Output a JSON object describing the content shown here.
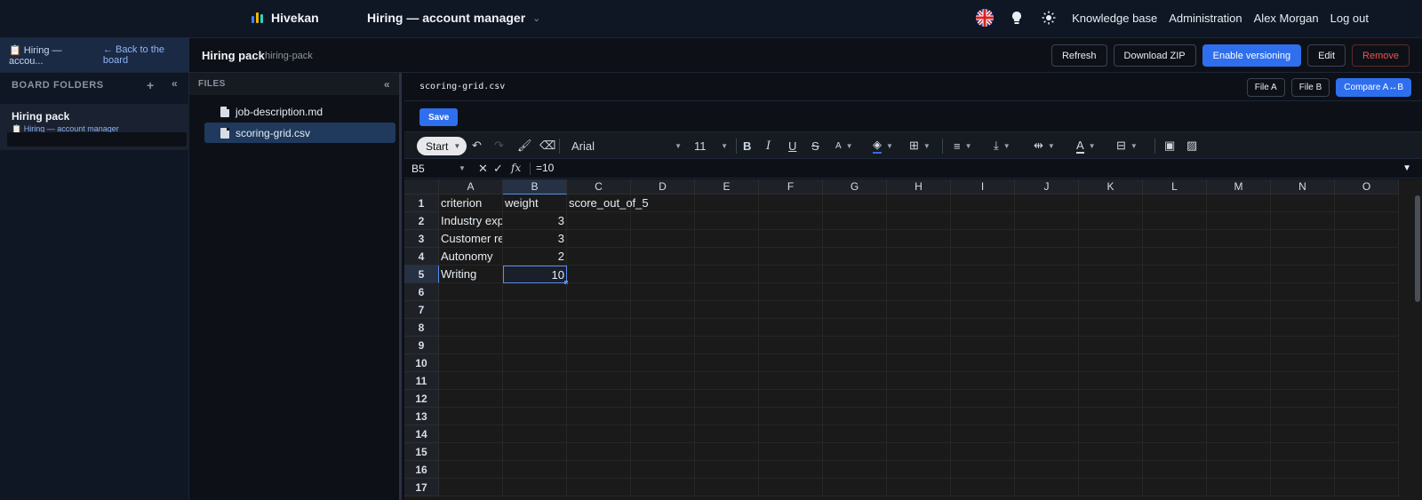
{
  "app": {
    "brand": "Hivekan",
    "board_title": "Hiring — account manager",
    "nav": [
      "Knowledge base",
      "Administration",
      "Alex Morgan",
      "Log out"
    ],
    "colors": {
      "primary": "#2f6fed",
      "danger": "#f0524f",
      "logo": [
        "#3b82f6",
        "#f5b400",
        "#2dd4bf"
      ]
    },
    "icons": [
      "uk-flag-icon",
      "lightbulb-icon",
      "sun-icon",
      "chevron-down-icon"
    ]
  },
  "subheader": {
    "crumb_icon": "📋",
    "crumb_label": "Hiring — accou...",
    "back_link": "← Back to the board",
    "pack_title": "Hiring pack",
    "pack_slug": "hiring-pack",
    "buttons": {
      "refresh": "Refresh",
      "download": "Download ZIP",
      "versioning": "Enable versioning",
      "edit": "Edit",
      "remove": "Remove"
    }
  },
  "sidebar": {
    "header": "BOARD FOLDERS",
    "add": "+",
    "collapse": "«",
    "folder": {
      "title": "Hiring pack",
      "sub_icon": "📋",
      "sub": "Hiring — account manager"
    }
  },
  "files": {
    "header": "FILES",
    "collapse": "«",
    "items": [
      "job-description.md",
      "scoring-grid.csv"
    ],
    "selected": "scoring-grid.csv"
  },
  "editor": {
    "file_name": "scoring-grid.csv",
    "file_a": "File A",
    "file_b": "File B",
    "compare": "Compare A↔B",
    "save": "Save",
    "toolbar": {
      "start": "Start",
      "font": "Arial",
      "size": "11",
      "icons": [
        "undo-icon",
        "redo-icon",
        "paint-format-icon",
        "clear-format-icon",
        "bold-icon",
        "italic-icon",
        "underline-icon",
        "strikethrough-icon",
        "font-size-icon",
        "fill-color-icon",
        "borders-icon",
        "align-icon",
        "valign-icon",
        "text-wrap-icon",
        "text-color-icon",
        "merge-icon",
        "insert-chart-icon",
        "insert-image-icon"
      ]
    },
    "formula": {
      "cell_ref": "B5",
      "value": "=10",
      "x": "✕",
      "check": "✓",
      "fx": "fx"
    }
  },
  "sheet": {
    "columns": [
      "A",
      "B",
      "C",
      "D",
      "E",
      "F",
      "G",
      "H",
      "I",
      "J",
      "K",
      "L",
      "M",
      "N",
      "O"
    ],
    "rows": [
      "1",
      "2",
      "3",
      "4",
      "5",
      "6",
      "7",
      "8",
      "9",
      "10",
      "11",
      "12",
      "13",
      "14",
      "15",
      "16",
      "17"
    ],
    "selected_col": "B",
    "selected_row": "5",
    "cells": [
      [
        "criterion",
        "weight",
        "score_out_of_5"
      ],
      [
        "Industry experience",
        "3",
        ""
      ],
      [
        "Customer relationship",
        "3",
        ""
      ],
      [
        "Autonomy",
        "2",
        ""
      ],
      [
        "Writing",
        "10",
        ""
      ]
    ]
  }
}
